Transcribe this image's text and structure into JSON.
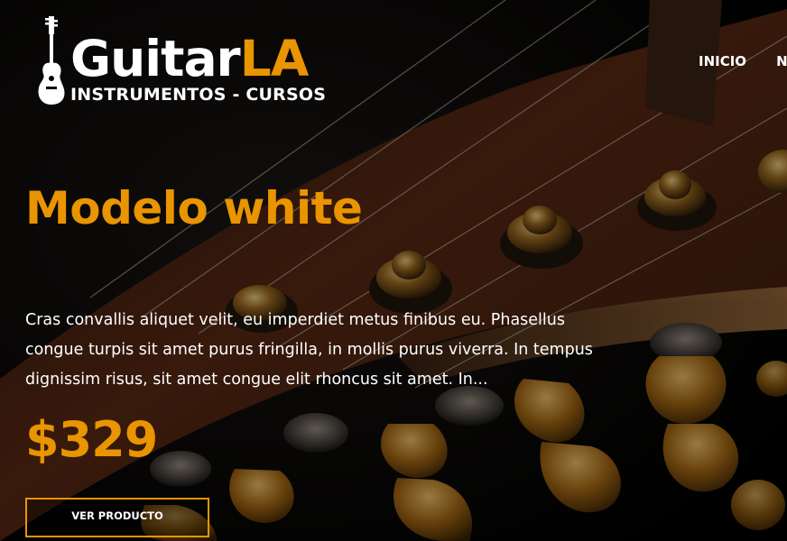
{
  "brand": {
    "name_main": "Guitar",
    "name_accent": "LA",
    "tagline": "INSTRUMENTOS - CURSOS"
  },
  "nav": {
    "items": [
      {
        "label": "INICIO"
      },
      {
        "label": "N"
      }
    ]
  },
  "product": {
    "title": "Modelo white",
    "description": "Cras convallis aliquet velit, eu imperdiet metus finibus eu. Phasellus congue turpis sit amet purus fringilla, in mollis purus viverra. In tempus dignissim risus, sit amet congue elit rhoncus sit amet. In...",
    "price": "$329",
    "button_label": "VER PRODUCTO"
  },
  "colors": {
    "accent": "#e99401",
    "text": "#ffffff",
    "background": "#000000"
  },
  "icons": {
    "logo": "guitar-icon"
  }
}
